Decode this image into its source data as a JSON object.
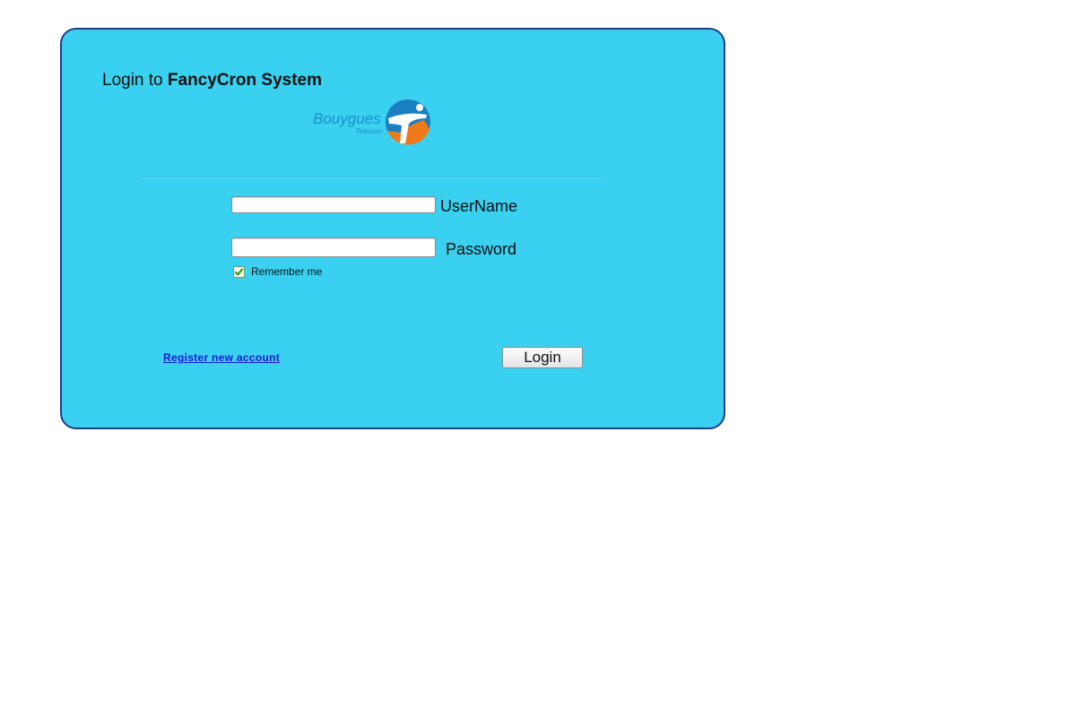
{
  "header": {
    "title_prefix": "Login to ",
    "title_brand": "FancyCron System"
  },
  "logo": {
    "word": "Bouygues",
    "subword": "Telecom",
    "colors": {
      "text": "#1b8fc8",
      "ball_blue": "#1a7fc0",
      "ball_orange": "#f07a1a"
    }
  },
  "form": {
    "username": {
      "label": "UserName",
      "value": "",
      "placeholder": ""
    },
    "password": {
      "label": "Password",
      "value": "",
      "placeholder": ""
    },
    "remember": {
      "label": "Remember me",
      "checked": true
    },
    "register_link": "Register new account",
    "login_button": "Login"
  },
  "colors": {
    "panel_background": "#3ad0f0",
    "panel_border": "#1a3f8c",
    "link": "#1a1ad8"
  }
}
